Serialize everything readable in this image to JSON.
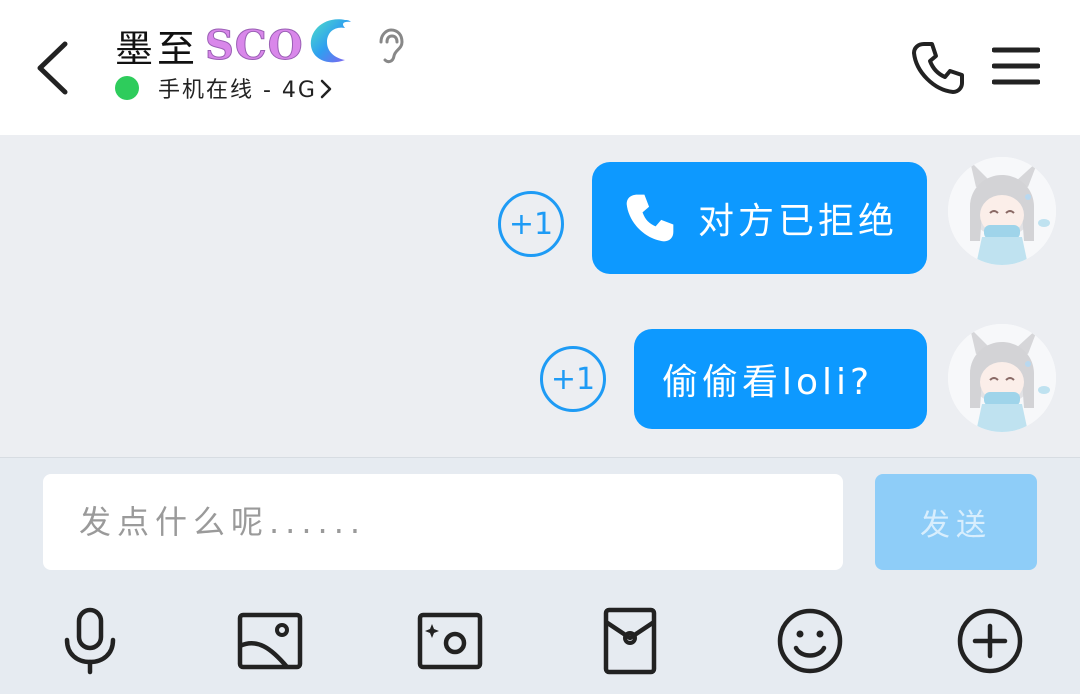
{
  "header": {
    "name": "墨至",
    "badge": "SCO",
    "status": "手机在线 - 4G",
    "status_color": "#2ecc5c"
  },
  "messages": [
    {
      "text": "对方已拒绝",
      "icon": "phone-icon",
      "reaction": "+1"
    },
    {
      "text": "偷偷看loli?",
      "reaction": "+1"
    }
  ],
  "input": {
    "placeholder": "发点什么呢......",
    "send_label": "发送"
  },
  "toolbar": [
    "microphone-icon",
    "image-icon",
    "camera-icon",
    "red-packet-icon",
    "emoji-icon",
    "plus-icon"
  ],
  "colors": {
    "bubble": "#0d99ff",
    "accent": "#1e9bf5",
    "send_button": "#8ecdf8"
  }
}
